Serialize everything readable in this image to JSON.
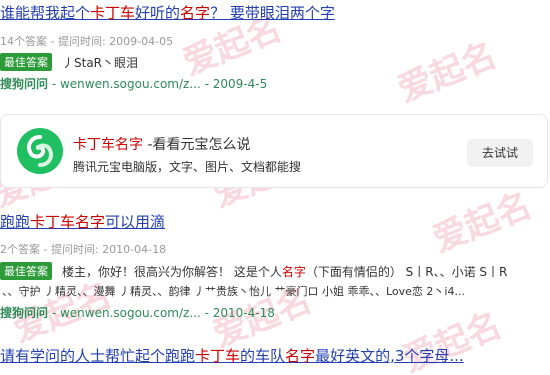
{
  "results": [
    {
      "title_pre": "谁能帮我起个",
      "title_hl1": "卡丁车",
      "title_mid": "好听的",
      "title_hl2": "名字",
      "title_post": "？ 要带眼泪两个字",
      "meta": "14个答案 - 提问时间: 2009-04-05",
      "badge": "最佳答案",
      "answer": "丿StaR丶眼泪",
      "source_brand": "搜狗问问",
      "source_url": " - wenwen.sogou.com/z... - 2009-4-5"
    },
    {
      "title_pre": "跑跑",
      "title_hl1": "卡丁车名字",
      "title_post": "可以用滴",
      "meta": "2个答案 - 提问时间: 2010-04-18",
      "badge": "最佳答案",
      "answer_pre": "楼主，你好！很高兴为你解答！ 这是个人",
      "answer_hl": "名字",
      "answer_post": "（下面有情侣的） S丨R、、小诺 S丨R",
      "answer_line2": "、、守护 丿精灵、、漫舞 丿精灵、、韵律 丿艹贵族丶怡儿 艹豪门ロ 小姐 乖乖、、Love恋 2丶i4...",
      "source_brand": "搜狗问问",
      "source_url": " - wenwen.sogou.com/z... - 2010-4-18"
    },
    {
      "title_pre": "请有学问的人士帮忙起个跑跑",
      "title_hl1": "卡丁车",
      "title_mid": "的车队",
      "title_hl2": "名字",
      "title_post": "最好英文的,3个字母..."
    }
  ],
  "card": {
    "title_hl": "卡丁车名字",
    "title_post": " -看看元宝怎么说",
    "desc": "腾讯元宝电脑版，文字、图片、文档都能搜",
    "button": "去试试"
  },
  "watermark_text": "爱起名",
  "colors": {
    "link": "#2440b3",
    "highlight": "#cc0000",
    "badge": "#2e9b3a",
    "source": "#2e8b57",
    "logo": "#1fbf62"
  }
}
